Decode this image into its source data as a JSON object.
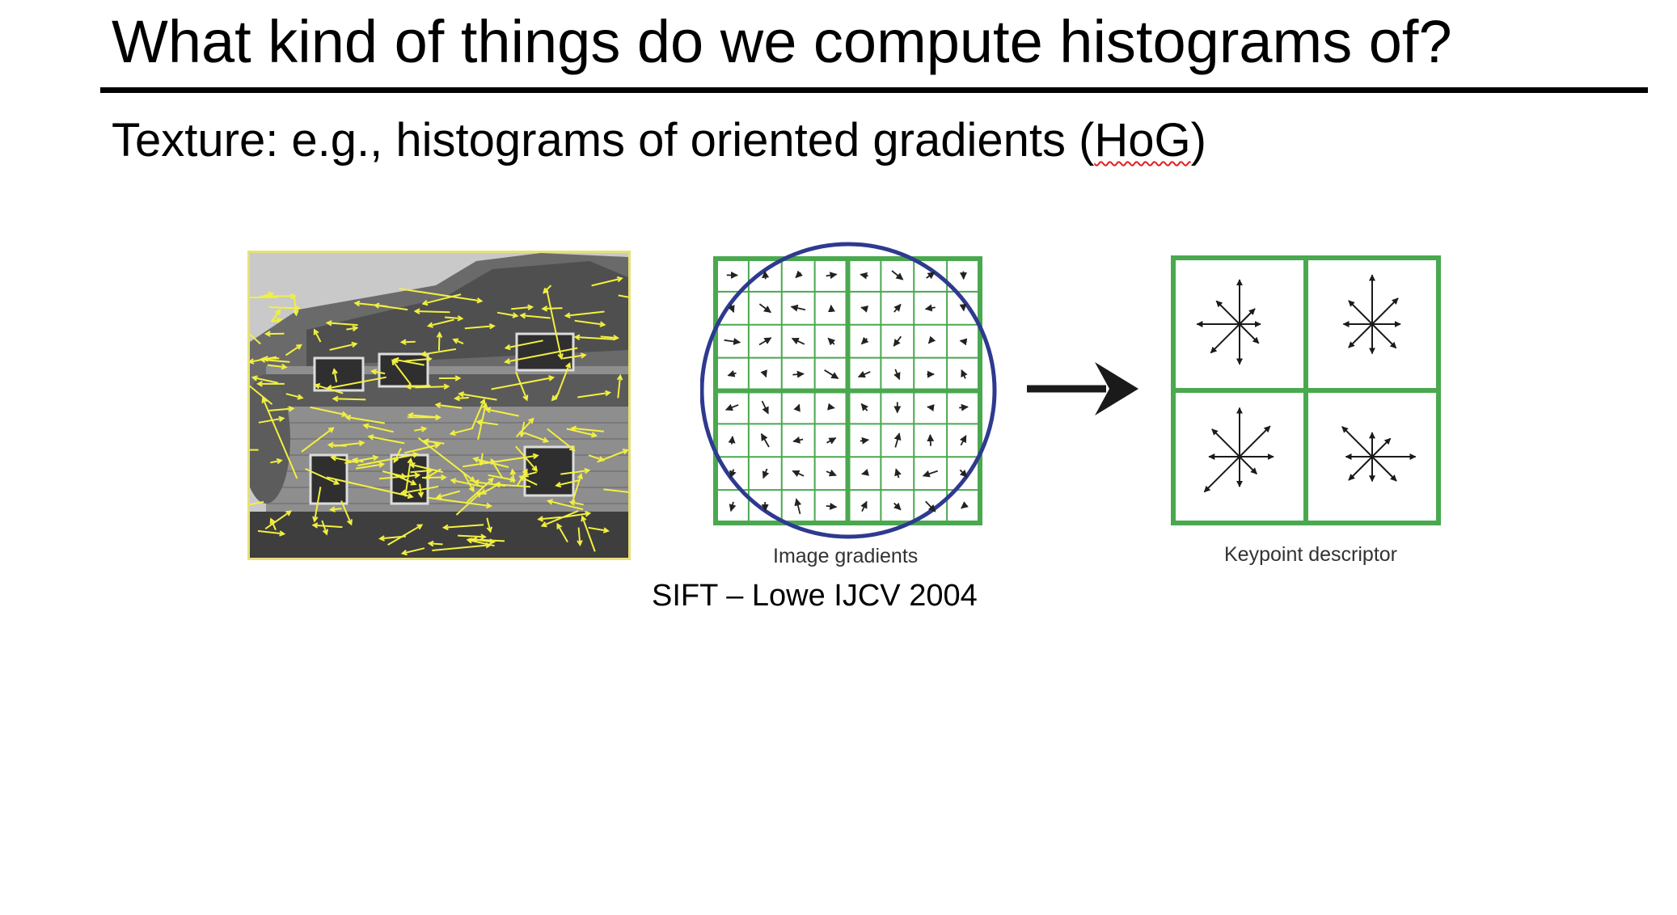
{
  "slide": {
    "title": "What kind of things do we compute histograms of?",
    "subtitle_prefix": "Texture: e.g., histograms of oriented gradients (",
    "subtitle_term": "HoG",
    "subtitle_suffix": ")"
  },
  "figure": {
    "photo_alt": "house photograph with yellow gradient arrows",
    "gradients_label": "Image gradients",
    "descriptor_label": "Keypoint descriptor",
    "arrow_icon": "right-arrow-icon",
    "caption": "SIFT – Lowe IJCV 2004"
  },
  "colors": {
    "grid": "#4aa84f",
    "circle": "#2e3a8f",
    "feature_arrows": "#f2f040",
    "photo_border": "#e8e07a"
  }
}
